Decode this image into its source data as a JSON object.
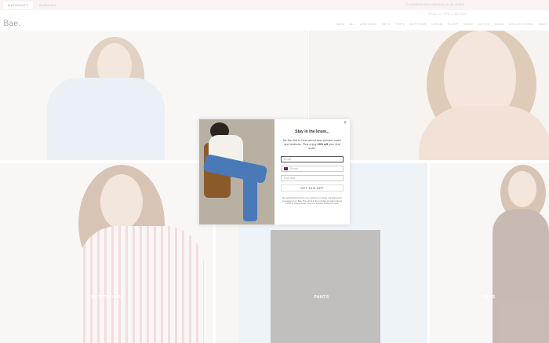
{
  "topbar": {
    "tabs": [
      "Maternity",
      "Nursing"
    ],
    "promo": "Complimentary shipping on all orders",
    "promo2": "Shop our new collection"
  },
  "header": {
    "logo": "Bae.",
    "nav": [
      "New",
      "All",
      "Dresses",
      "Sets",
      "Tops",
      "Bottoms",
      "Denim",
      "Sleep",
      "Swim",
      "Active",
      "Base",
      "Collections",
      "Sale"
    ]
  },
  "tiles": [
    {
      "label": "Button-Ups"
    },
    {
      "label": "Pants"
    },
    {
      "label": "Sets"
    }
  ],
  "modal": {
    "title": "Stay in the know...",
    "desc_pre": "Be the first to hear about new arrivals, sales and restocks. Plus enjoy ",
    "desc_bold": "10% off",
    "desc_post": " your first order.",
    "email_placeholder": "Email",
    "phone_placeholder": "Phone",
    "dob_placeholder": "Due date",
    "submit_label": "Get 10% off",
    "legal": "By submitting this form you consent to receive marketing text messages from Bae The Label at the number provided. Reply STOP to unsubscribe. View our Privacy Policy for more.",
    "close_label": "×"
  },
  "colors": {
    "topbar_bg": "#f6e9e5",
    "accent": "#222222"
  }
}
